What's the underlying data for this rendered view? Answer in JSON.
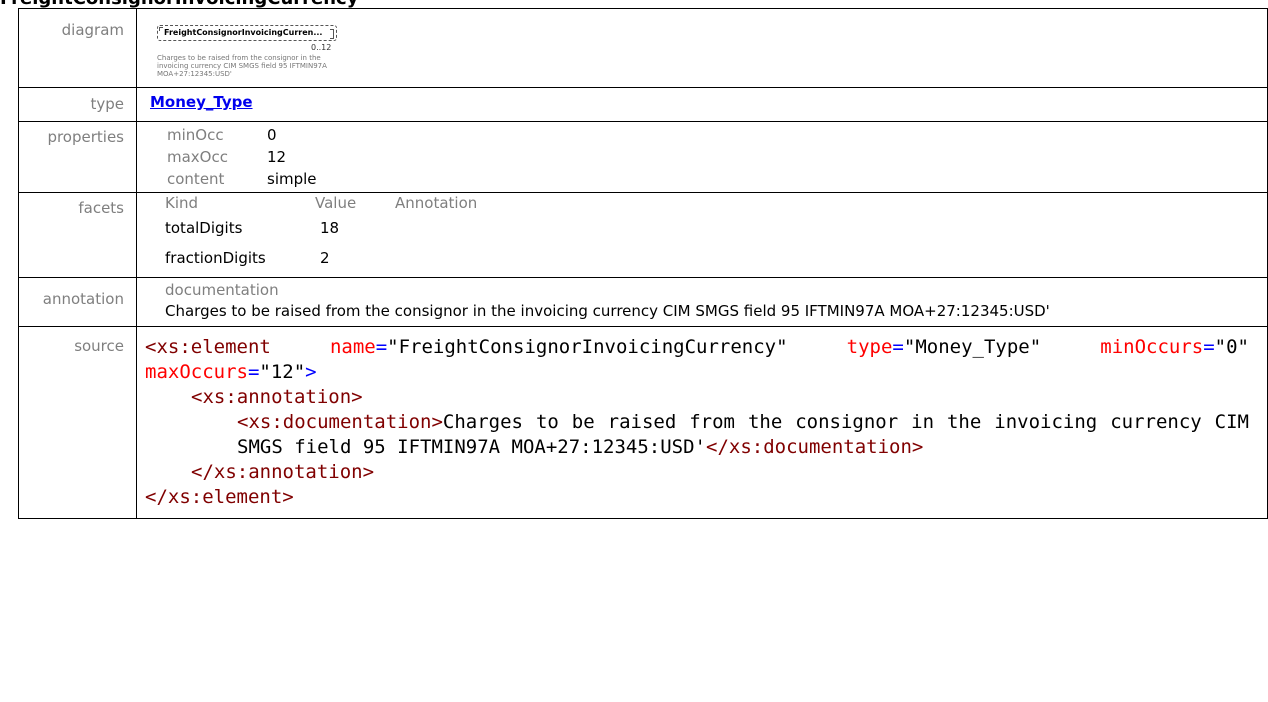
{
  "page_title": "FreightConsignorInvoicingCurrency",
  "labels": {
    "diagram": "diagram",
    "type": "type",
    "properties": "properties",
    "facets": "facets",
    "annotation": "annotation",
    "source": "source"
  },
  "diagram": {
    "box_text": "FreightConsignorInvoicingCurren...",
    "occurrence": "0..12",
    "note": "Charges to be raised from the consignor in the invoicing currency CIM SMGS field 95 IFTMIN97A MOA+27:12345:USD'"
  },
  "type": {
    "link": "Money_Type"
  },
  "properties": [
    {
      "key": "minOcc",
      "value": "0"
    },
    {
      "key": "maxOcc",
      "value": "12"
    },
    {
      "key": "content",
      "value": "simple"
    }
  ],
  "facets": {
    "headers": [
      "Kind",
      "Value",
      "Annotation"
    ],
    "rows": [
      {
        "kind": "totalDigits",
        "value": "18"
      },
      {
        "kind": "fractionDigits",
        "value": "2"
      }
    ]
  },
  "annotation": {
    "heading": "documentation",
    "text": "Charges to be raised from the consignor in the invoicing currency CIM SMGS field 95 IFTMIN97A MOA+27:12345:USD'"
  },
  "source": {
    "el_open": "<xs:element",
    "attr_name": "name",
    "val_name": "\"FreightConsignorInvoicingCurrency\"",
    "attr_type": "type",
    "val_type": "\"Money_Type\"",
    "attr_min": "minOccurs",
    "val_min": "\"0\"",
    "attr_max": "maxOccurs",
    "val_max": "\"12\"",
    "ann_open": "<xs:annotation>",
    "doc_open": "<xs:documentation>",
    "doc_text": "Charges to be raised from the consignor in the invoicing currency CIM SMGS field 95 IFTMIN97A MOA+27:12345:USD'",
    "doc_close": "</xs:documentation>",
    "ann_close": "</xs:annotation>",
    "el_close": "</xs:element>"
  }
}
